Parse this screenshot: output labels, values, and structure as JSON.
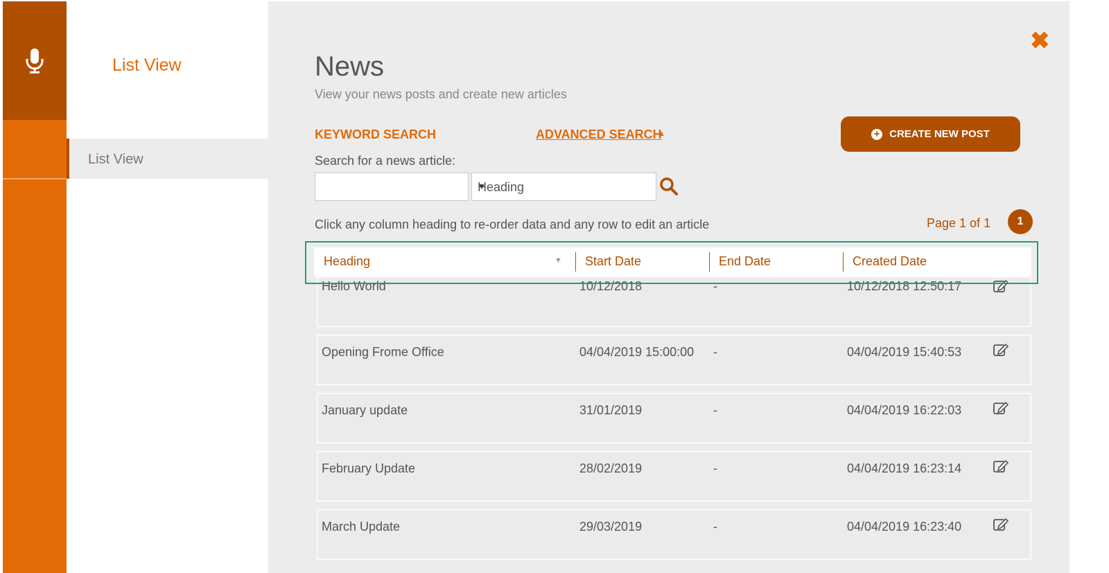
{
  "sidebar": {
    "title": "List View",
    "items": [
      {
        "label": "List View"
      }
    ]
  },
  "main": {
    "title": "News",
    "subtitle": "View your news posts and create new articles",
    "close_glyph": "✖",
    "tabs": {
      "keyword": "KEYWORD SEARCH",
      "advanced": "ADVANCED SEARCH"
    },
    "create_button": "CREATE NEW POST",
    "search": {
      "label": "Search for a news article:",
      "value": "",
      "field_selected": "Heading"
    },
    "hint": "Click any column heading to re-order data and any row to edit an article",
    "pagination": {
      "info": "Page 1 of 1",
      "current": "1"
    }
  },
  "table": {
    "columns": [
      "Heading",
      "Start Date",
      "End Date",
      "Created Date"
    ],
    "rows": [
      {
        "heading": "Hello World",
        "start": "10/12/2018",
        "end": "-",
        "created": "10/12/2018 12:50:17"
      },
      {
        "heading": "Opening Frome Office",
        "start": "04/04/2019 15:00:00",
        "end": "-",
        "created": "04/04/2019 15:40:53"
      },
      {
        "heading": "January update",
        "start": "31/01/2019",
        "end": "-",
        "created": "04/04/2019 16:22:03"
      },
      {
        "heading": "February Update",
        "start": "28/02/2019",
        "end": "-",
        "created": "04/04/2019 16:23:14"
      },
      {
        "heading": "March Update",
        "start": "29/03/2019",
        "end": "-",
        "created": "04/04/2019 16:23:40"
      }
    ]
  },
  "icons": {
    "rail": "microphone-icon",
    "close": "close-icon",
    "search": "search-icon",
    "create": "plus-circle-icon",
    "edit": "edit-icon"
  },
  "colors": {
    "accent": "#e46a05",
    "accent_dark": "#b04f00",
    "highlight": "#1a9e84"
  }
}
